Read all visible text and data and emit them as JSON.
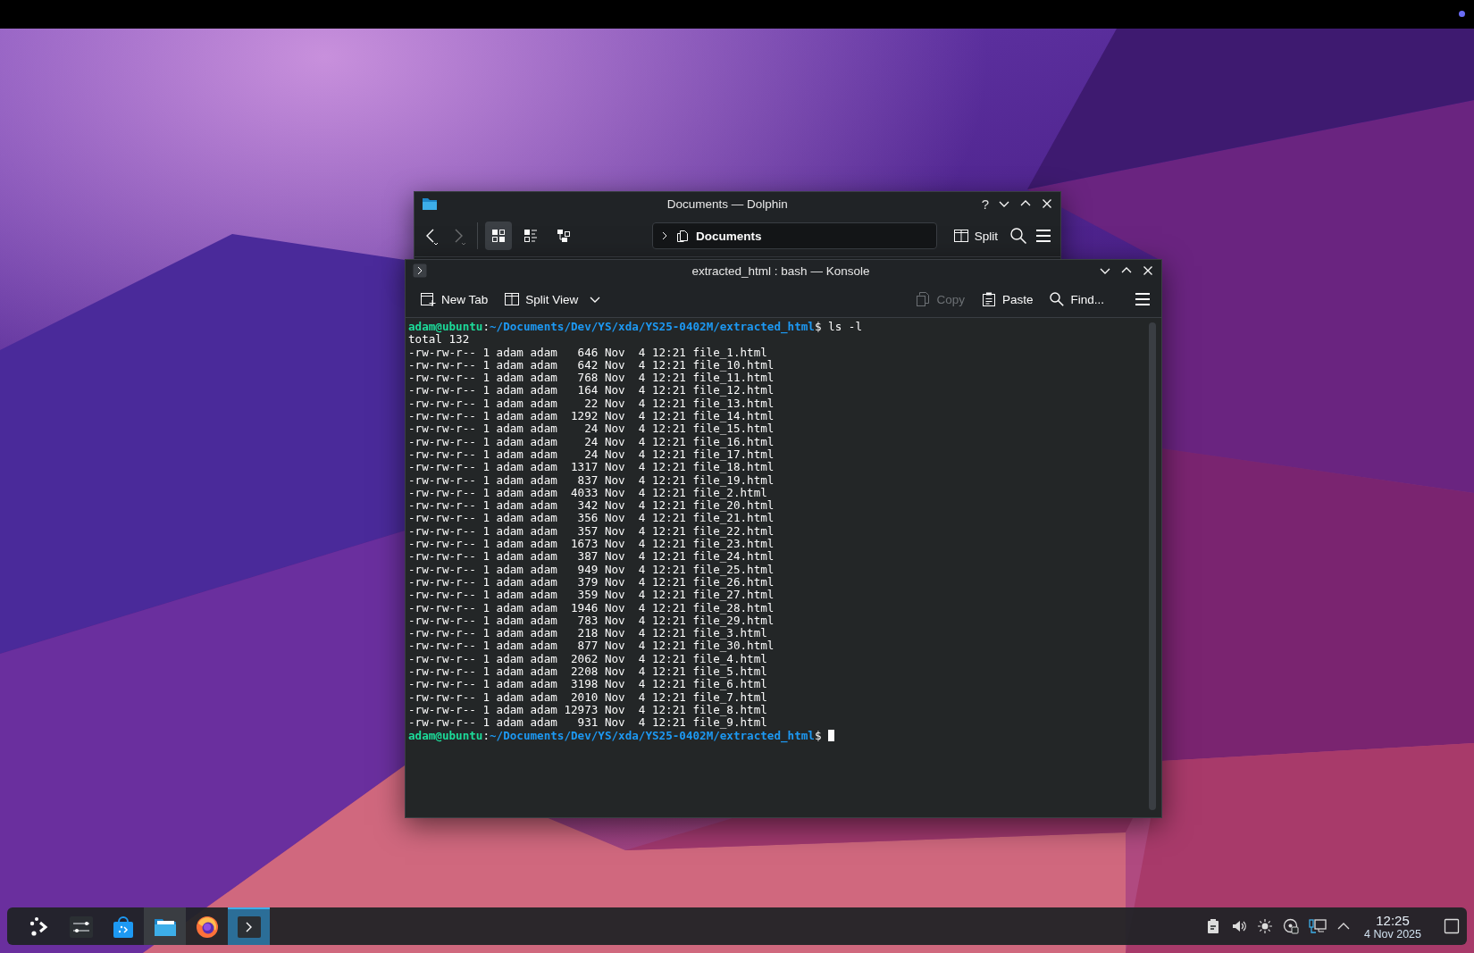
{
  "dolphin": {
    "title": "Documents — Dolphin",
    "help": "?",
    "back": {
      "disabled": false
    },
    "forward": {
      "disabled": true
    },
    "view_modes": [
      {
        "kind": "icons",
        "selected": true
      },
      {
        "kind": "compact",
        "selected": false
      },
      {
        "kind": "details",
        "selected": false
      }
    ],
    "location": "Documents",
    "split": "Split"
  },
  "konsole": {
    "title": "extracted_html : bash — Konsole",
    "toolbar": [
      {
        "kind": "new-tab",
        "label": "New Tab",
        "disabled": false
      },
      {
        "kind": "split-view",
        "label": "Split View",
        "disabled": false
      },
      {
        "kind": "copy",
        "label": "Copy",
        "disabled": true
      },
      {
        "kind": "paste",
        "label": "Paste",
        "disabled": false
      },
      {
        "kind": "find",
        "label": "Find...",
        "disabled": false
      }
    ],
    "lines": [
      {
        "kind": "prompt",
        "user": "adam@ubuntu",
        "sep": ":",
        "path": "~/Documents/Dev/YS/xda/YS25-0402M/extracted_html",
        "suffix": "$ ls -l",
        "cursor": false
      },
      {
        "kind": "output",
        "text": "total 132"
      },
      {
        "kind": "output",
        "text": "-rw-rw-r-- 1 adam adam   646 Nov  4 12:21 file_1.html"
      },
      {
        "kind": "output",
        "text": "-rw-rw-r-- 1 adam adam   642 Nov  4 12:21 file_10.html"
      },
      {
        "kind": "output",
        "text": "-rw-rw-r-- 1 adam adam   768 Nov  4 12:21 file_11.html"
      },
      {
        "kind": "output",
        "text": "-rw-rw-r-- 1 adam adam   164 Nov  4 12:21 file_12.html"
      },
      {
        "kind": "output",
        "text": "-rw-rw-r-- 1 adam adam    22 Nov  4 12:21 file_13.html"
      },
      {
        "kind": "output",
        "text": "-rw-rw-r-- 1 adam adam  1292 Nov  4 12:21 file_14.html"
      },
      {
        "kind": "output",
        "text": "-rw-rw-r-- 1 adam adam    24 Nov  4 12:21 file_15.html"
      },
      {
        "kind": "output",
        "text": "-rw-rw-r-- 1 adam adam    24 Nov  4 12:21 file_16.html"
      },
      {
        "kind": "output",
        "text": "-rw-rw-r-- 1 adam adam    24 Nov  4 12:21 file_17.html"
      },
      {
        "kind": "output",
        "text": "-rw-rw-r-- 1 adam adam  1317 Nov  4 12:21 file_18.html"
      },
      {
        "kind": "output",
        "text": "-rw-rw-r-- 1 adam adam   837 Nov  4 12:21 file_19.html"
      },
      {
        "kind": "output",
        "text": "-rw-rw-r-- 1 adam adam  4033 Nov  4 12:21 file_2.html"
      },
      {
        "kind": "output",
        "text": "-rw-rw-r-- 1 adam adam   342 Nov  4 12:21 file_20.html"
      },
      {
        "kind": "output",
        "text": "-rw-rw-r-- 1 adam adam   356 Nov  4 12:21 file_21.html"
      },
      {
        "kind": "output",
        "text": "-rw-rw-r-- 1 adam adam   357 Nov  4 12:21 file_22.html"
      },
      {
        "kind": "output",
        "text": "-rw-rw-r-- 1 adam adam  1673 Nov  4 12:21 file_23.html"
      },
      {
        "kind": "output",
        "text": "-rw-rw-r-- 1 adam adam   387 Nov  4 12:21 file_24.html"
      },
      {
        "kind": "output",
        "text": "-rw-rw-r-- 1 adam adam   949 Nov  4 12:21 file_25.html"
      },
      {
        "kind": "output",
        "text": "-rw-rw-r-- 1 adam adam   379 Nov  4 12:21 file_26.html"
      },
      {
        "kind": "output",
        "text": "-rw-rw-r-- 1 adam adam   359 Nov  4 12:21 file_27.html"
      },
      {
        "kind": "output",
        "text": "-rw-rw-r-- 1 adam adam  1946 Nov  4 12:21 file_28.html"
      },
      {
        "kind": "output",
        "text": "-rw-rw-r-- 1 adam adam   783 Nov  4 12:21 file_29.html"
      },
      {
        "kind": "output",
        "text": "-rw-rw-r-- 1 adam adam   218 Nov  4 12:21 file_3.html"
      },
      {
        "kind": "output",
        "text": "-rw-rw-r-- 1 adam adam   877 Nov  4 12:21 file_30.html"
      },
      {
        "kind": "output",
        "text": "-rw-rw-r-- 1 adam adam  2062 Nov  4 12:21 file_4.html"
      },
      {
        "kind": "output",
        "text": "-rw-rw-r-- 1 adam adam  2208 Nov  4 12:21 file_5.html"
      },
      {
        "kind": "output",
        "text": "-rw-rw-r-- 1 adam adam  3198 Nov  4 12:21 file_6.html"
      },
      {
        "kind": "output",
        "text": "-rw-rw-r-- 1 adam adam  2010 Nov  4 12:21 file_7.html"
      },
      {
        "kind": "output",
        "text": "-rw-rw-r-- 1 adam adam 12973 Nov  4 12:21 file_8.html"
      },
      {
        "kind": "output",
        "text": "-rw-rw-r-- 1 adam adam   931 Nov  4 12:21 file_9.html"
      },
      {
        "kind": "prompt",
        "user": "adam@ubuntu",
        "sep": ":",
        "path": "~/Documents/Dev/YS/xda/YS25-0402M/extracted_html",
        "suffix": "$ ",
        "cursor": true
      }
    ]
  },
  "taskbar": {
    "apps": [
      {
        "kind": "launcher",
        "running": false,
        "selected": false
      },
      {
        "kind": "settings",
        "running": false,
        "selected": false
      },
      {
        "kind": "store",
        "running": false,
        "selected": false
      },
      {
        "kind": "files",
        "running": true,
        "selected": false
      },
      {
        "kind": "browser",
        "running": false,
        "selected": false
      },
      {
        "kind": "terminal",
        "running": true,
        "selected": true
      }
    ],
    "time": "12:25",
    "date": "4 Nov 2025"
  }
}
